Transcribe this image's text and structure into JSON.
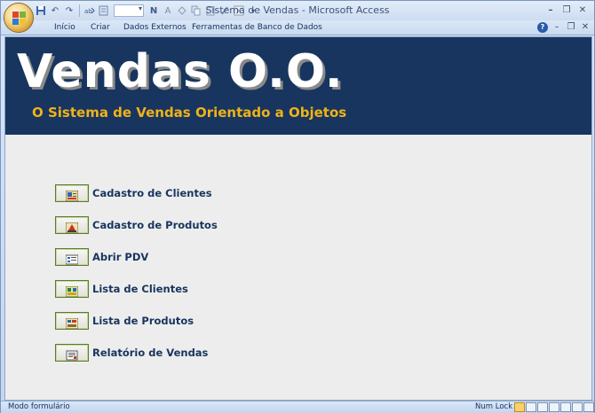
{
  "window": {
    "title": "Sistema de Vendas",
    "title_sep": " - ",
    "app_name": "Microsoft Access"
  },
  "quick_access": {
    "icons": [
      "save-icon",
      "undo-icon",
      "redo-icon",
      "find-replace-icon",
      "filter-icon",
      "font-select",
      "bold-icon",
      "font-color-icon",
      "fill-color-icon",
      "copy-icon",
      "paste-icon",
      "format-painter-icon",
      "close-doc-icon",
      "customize-icon"
    ]
  },
  "ribbon_tabs": [
    "Início",
    "Criar",
    "Dados Externos",
    "Ferramentas de Banco de Dados"
  ],
  "form": {
    "title": "Vendas O.O.",
    "subtitle": "O Sistema de Vendas Orientado a Objetos",
    "colors": {
      "header_bg": "#17355e",
      "title": "#ffffff",
      "subtitle": "#f0b21a",
      "label": "#17355e",
      "body_bg": "#ededed"
    },
    "menu": [
      {
        "label": "Cadastro de Clientes",
        "icon": "customers-form-icon"
      },
      {
        "label": "Cadastro de Produtos",
        "icon": "products-form-icon"
      },
      {
        "label": "Abrir PDV",
        "icon": "pos-form-icon"
      },
      {
        "label": "Lista de Clientes",
        "icon": "customers-list-icon"
      },
      {
        "label": "Lista de Produtos",
        "icon": "products-list-icon"
      },
      {
        "label": "Relatório de Vendas",
        "icon": "sales-report-icon"
      }
    ]
  },
  "status": {
    "mode": "Modo formulário",
    "numlock": "Num Lock"
  }
}
